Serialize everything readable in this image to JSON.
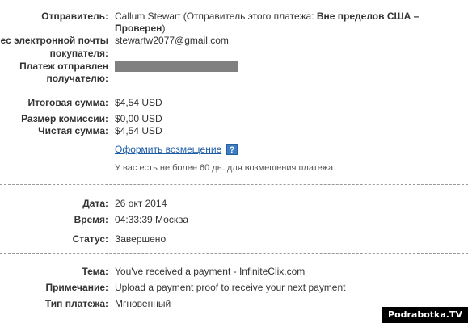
{
  "sender": {
    "label": "Отправитель:",
    "value_line1_prefix": "Callum Stewart (Отправитель этого платежа: ",
    "value_line1_bold": "Вне пределов США –",
    "value_line2_bold": "Проверен",
    "value_line2_suffix": ")"
  },
  "email": {
    "label_line1": "рес электронной почты",
    "label_line2": "покупателя:",
    "value": "stewartw2077@gmail.com"
  },
  "recipient": {
    "label_line1": "Платеж отправлен",
    "label_line2": "получателю:"
  },
  "amounts": {
    "total_label": "Итоговая сумма:",
    "total_value": "$4,54 USD",
    "fee_label": "Размер комиссии:",
    "fee_value": "$0,00 USD",
    "net_label": "Чистая сумма:",
    "net_value": "$4,54 USD"
  },
  "refund": {
    "link": "Оформить возмещение",
    "help_glyph": "?",
    "note": "У вас есть не более 60 дн. для возмещения платежа."
  },
  "details": {
    "date_label": "Дата:",
    "date_value": "26 окт 2014",
    "time_label": "Время:",
    "time_value": "04:33:39 Москва",
    "status_label": "Статус:",
    "status_value": "Завершено"
  },
  "payment": {
    "subject_label": "Тема:",
    "subject_value": "You've received a payment - InfiniteClix.com",
    "note_label": "Примечание:",
    "note_value": "Upload a payment proof to receive your next payment",
    "type_label": "Тип платежа:",
    "type_value": "Мгновенный"
  },
  "watermark": "Podrabotka.TV"
}
